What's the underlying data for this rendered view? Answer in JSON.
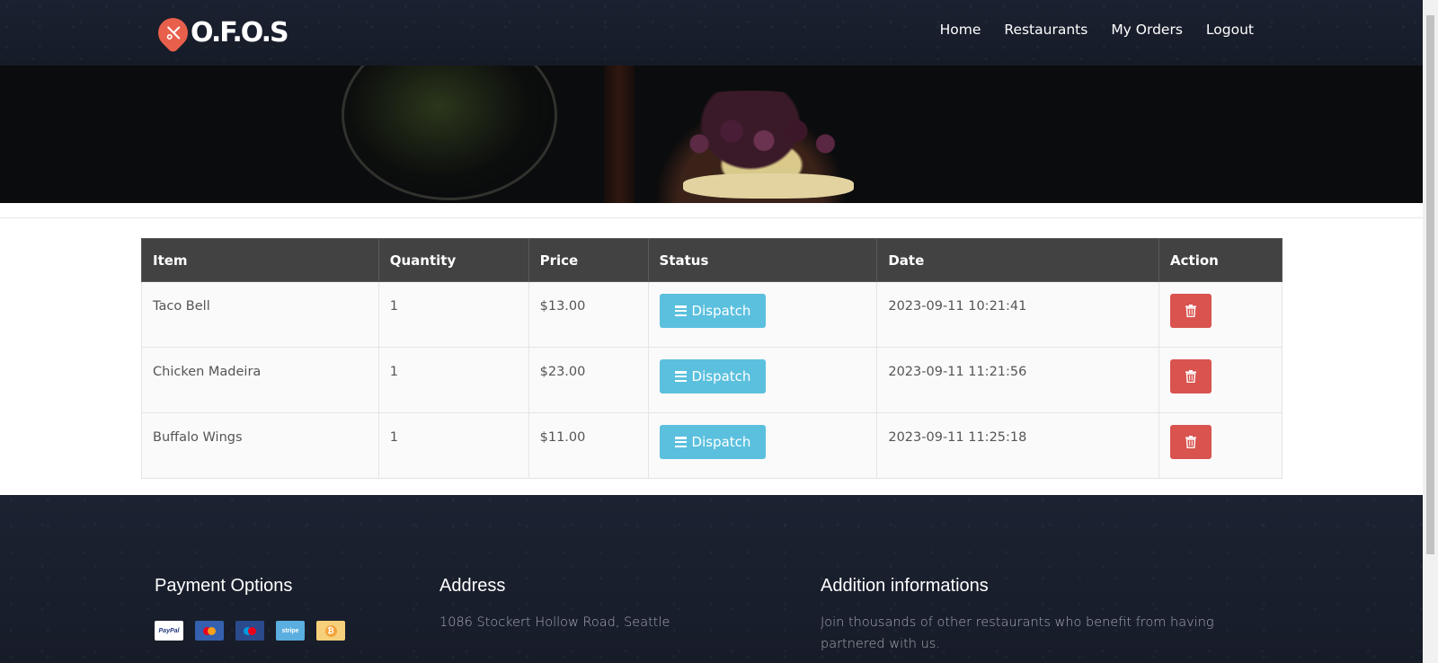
{
  "brand": {
    "logo_text": "O.F.O.S"
  },
  "nav": {
    "items": [
      {
        "label": "Home"
      },
      {
        "label": "Restaurants"
      },
      {
        "label": "My Orders"
      },
      {
        "label": "Logout"
      }
    ]
  },
  "orders": {
    "columns": [
      "Item",
      "Quantity",
      "Price",
      "Status",
      "Date",
      "Action"
    ],
    "rows": [
      {
        "item": "Taco Bell",
        "quantity": "1",
        "price": "$13.00",
        "status": "Dispatch",
        "date": "2023-09-11 10:21:41"
      },
      {
        "item": "Chicken Madeira",
        "quantity": "1",
        "price": "$23.00",
        "status": "Dispatch",
        "date": "2023-09-11 11:21:56"
      },
      {
        "item": "Buffalo Wings",
        "quantity": "1",
        "price": "$11.00",
        "status": "Dispatch",
        "date": "2023-09-11 11:25:18"
      }
    ],
    "status_color": "#5bc0de",
    "delete_color": "#d9534f"
  },
  "footer": {
    "payment": {
      "title": "Payment Options",
      "icons": [
        "paypal-icon",
        "mastercard-icon",
        "maestro-icon",
        "stripe-icon",
        "bitcoin-icon"
      ],
      "paypal_text": "PayPal",
      "stripe_text": "stripe"
    },
    "address": {
      "title": "Address",
      "text": "1086 Stockert Hollow Road, Seattle"
    },
    "info": {
      "title": "Addition informations",
      "text": "Join thousands of other restaurants who benefit from having partnered with us."
    }
  },
  "theme": {
    "header_bg": "#1b2130",
    "table_header_bg": "#424242",
    "accent": "#e8604c"
  }
}
